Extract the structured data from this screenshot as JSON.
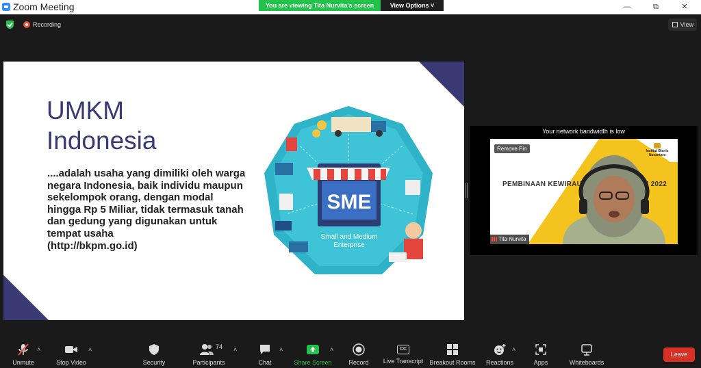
{
  "window": {
    "title": "Zoom Meeting",
    "viewing_banner": "You are viewing Tita Nurvita's screen",
    "view_options_label": "View Options ˅",
    "minimize_glyph": "—",
    "restore_glyph": "⧉",
    "close_glyph": "✕"
  },
  "status": {
    "recording_label": "Recording",
    "view_label": "View"
  },
  "slide": {
    "title": "UMKM\nIndonesia",
    "body": "....adalah usaha yang dimiliki oleh warga negara Indonesia, baik individu maupun sekelompok orang, dengan modal hingga Rp 5 Miliar, tidak termasuk tanah dan gedung yang digunakan untuk tempat usaha",
    "source": "(http://bkpm.go.id)",
    "art_label": "SME",
    "art_sublabel_1": "Small and Medium",
    "art_sublabel_2": "Enterprise"
  },
  "video": {
    "bandwidth_notice": "Your network bandwidth is low",
    "remove_pin_label": "Remove Pin",
    "participant_name": "Tita Nurvita",
    "banner_text": "PEMBINAAN KEWIRAUSAHAAN TERPADU 2022",
    "org_name": "Institut Bisnis Nusantara"
  },
  "toolbar": {
    "unmute": "Unmute",
    "stop_video": "Stop Video",
    "security": "Security",
    "participants": "Participants",
    "participants_count": "74",
    "chat": "Chat",
    "share_screen": "Share Screen",
    "record": "Record",
    "live_transcript": "Live Transcript",
    "cc_glyph": "CC",
    "breakout_rooms": "Breakout Rooms",
    "reactions": "Reactions",
    "apps": "Apps",
    "whiteboards": "Whiteboards",
    "leave": "Leave",
    "caret": "˄"
  },
  "colors": {
    "accent_green": "#23c24a",
    "slide_navy": "#393a73",
    "leave_red": "#d93025",
    "recording_red": "#e84d3d",
    "video_yellow": "#f4c31d"
  },
  "icons": [
    "zoom-logo-icon",
    "shield-icon",
    "recording-icon",
    "view-grid-icon",
    "mic-muted-icon",
    "video-camera-icon",
    "security-shield-icon",
    "participants-icon",
    "chat-bubble-icon",
    "share-screen-icon",
    "record-icon",
    "closed-caption-icon",
    "breakout-rooms-icon",
    "reactions-icon",
    "apps-icon",
    "whiteboard-icon"
  ]
}
